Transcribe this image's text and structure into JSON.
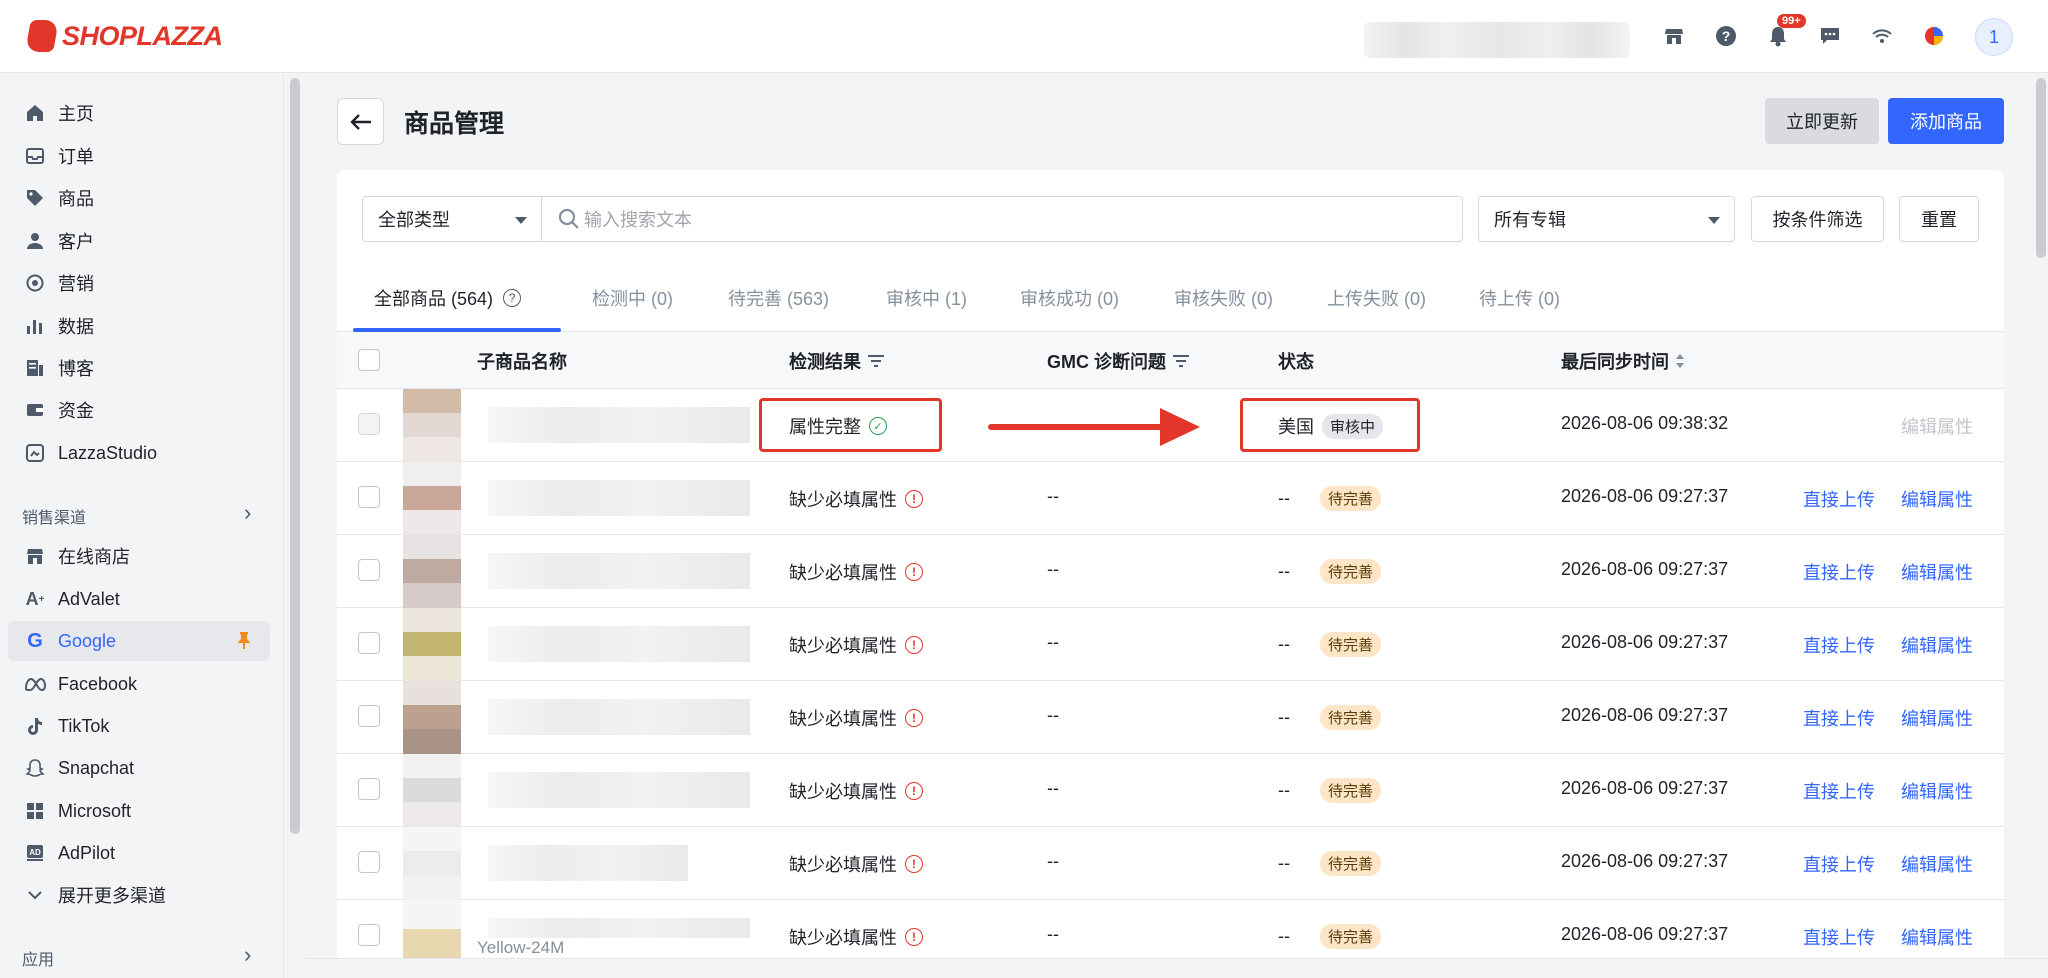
{
  "brand": {
    "name": "SHOPLAZZA",
    "color": "#e2362b"
  },
  "header": {
    "notifications_badge": "99+",
    "avatar_initial": "1"
  },
  "sidebar": {
    "items": [
      {
        "label": "主页",
        "icon": "home-icon"
      },
      {
        "label": "订单",
        "icon": "inbox-icon"
      },
      {
        "label": "商品",
        "icon": "tag-icon"
      },
      {
        "label": "客户",
        "icon": "person-icon"
      },
      {
        "label": "营销",
        "icon": "target-icon"
      },
      {
        "label": "数据",
        "icon": "bar-chart-icon"
      },
      {
        "label": "博客",
        "icon": "blog-icon"
      },
      {
        "label": "资金",
        "icon": "wallet-icon"
      },
      {
        "label": "LazzaStudio",
        "icon": "studio-icon"
      }
    ],
    "sales_channels_label": "销售渠道",
    "channels": [
      {
        "label": "在线商店",
        "icon": "store-icon"
      },
      {
        "label": "AdValet",
        "icon": "advalet-icon"
      },
      {
        "label": "Google",
        "icon": "google-icon",
        "active": true
      },
      {
        "label": "Facebook",
        "icon": "meta-icon"
      },
      {
        "label": "TikTok",
        "icon": "tiktok-icon"
      },
      {
        "label": "Snapchat",
        "icon": "snapchat-icon"
      },
      {
        "label": "Microsoft",
        "icon": "microsoft-icon"
      },
      {
        "label": "AdPilot",
        "icon": "adpilot-icon"
      }
    ],
    "expand_more": "展开更多渠道",
    "apps_label": "应用"
  },
  "page": {
    "title": "商品管理",
    "update_button": "立即更新",
    "add_button": "添加商品"
  },
  "filters": {
    "type_select": "全部类型",
    "search_placeholder": "输入搜索文本",
    "collection_select": "所有专辑",
    "filter_button": "按条件筛选",
    "reset_button": "重置"
  },
  "tabs": [
    {
      "label": "全部商品 (564)",
      "active": true
    },
    {
      "label": "检测中 (0)"
    },
    {
      "label": "待完善 (563)"
    },
    {
      "label": "审核中 (1)"
    },
    {
      "label": "审核成功 (0)"
    },
    {
      "label": "审核失败 (0)"
    },
    {
      "label": "上传失败 (0)"
    },
    {
      "label": "待上传 (0)"
    }
  ],
  "table": {
    "headers": {
      "name": "子商品名称",
      "detect": "检测结果",
      "gmc": "GMC 诊断问题",
      "status": "状态",
      "sync": "最后同步时间"
    },
    "rows": [
      {
        "detect": "属性完整",
        "detect_ok": true,
        "gmc": "",
        "region": "美国",
        "status": "审核中",
        "sync": "2026-08-06 09:38:32",
        "upload": "",
        "edit": "编辑属性",
        "edit_disabled": true
      },
      {
        "detect": "缺少必填属性",
        "gmc": "--",
        "region": "--",
        "status": "待完善",
        "sync": "2026-08-06 09:27:37",
        "upload": "直接上传",
        "edit": "编辑属性"
      },
      {
        "detect": "缺少必填属性",
        "gmc": "--",
        "region": "--",
        "status": "待完善",
        "sync": "2026-08-06 09:27:37",
        "upload": "直接上传",
        "edit": "编辑属性"
      },
      {
        "detect": "缺少必填属性",
        "gmc": "--",
        "region": "--",
        "status": "待完善",
        "sync": "2026-08-06 09:27:37",
        "upload": "直接上传",
        "edit": "编辑属性"
      },
      {
        "detect": "缺少必填属性",
        "gmc": "--",
        "region": "--",
        "status": "待完善",
        "sync": "2026-08-06 09:27:37",
        "upload": "直接上传",
        "edit": "编辑属性"
      },
      {
        "detect": "缺少必填属性",
        "gmc": "--",
        "region": "--",
        "status": "待完善",
        "sync": "2026-08-06 09:27:37",
        "upload": "直接上传",
        "edit": "编辑属性"
      },
      {
        "detect": "缺少必填属性",
        "gmc": "--",
        "region": "--",
        "status": "待完善",
        "sync": "2026-08-06 09:27:37",
        "upload": "直接上传",
        "edit": "编辑属性"
      },
      {
        "detect": "缺少必填属性",
        "gmc": "--",
        "region": "--",
        "status": "待完善",
        "sync": "2026-08-06 09:27:37",
        "upload": "直接上传",
        "edit": "编辑属性",
        "name_partial": "Yellow-24M"
      }
    ]
  },
  "colors": {
    "primary": "#3366ff",
    "danger": "#e2362b",
    "success": "#21a453",
    "warning_bg": "#fde6c7"
  }
}
